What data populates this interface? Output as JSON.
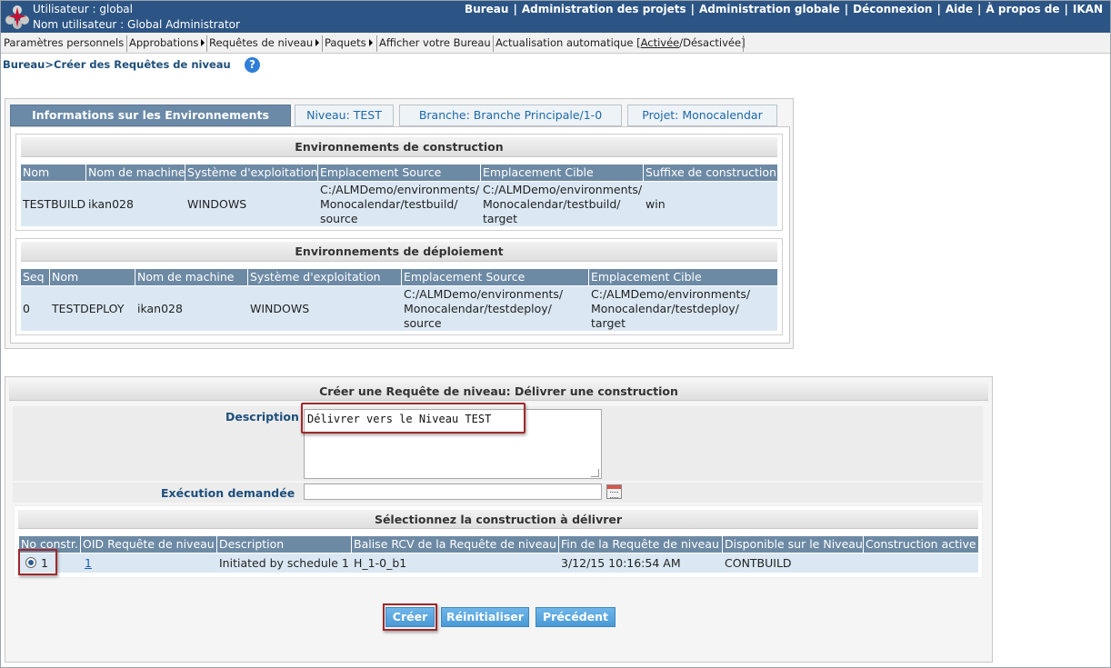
{
  "header": {
    "user_line": "Utilisateur : global",
    "name_line": "Nom utilisateur : Global Administrator",
    "nav": [
      "Bureau",
      "Administration des projets",
      "Administration globale",
      "Déconnexion",
      "Aide",
      "À propos de",
      "IKAN"
    ]
  },
  "menu": {
    "items": [
      "Paramètres personnels",
      "Approbations",
      "Requêtes de niveau",
      "Paquets",
      "Afficher votre Bureau",
      "Actualisation automatique ["
    ],
    "auto_active": "Activée",
    "auto_sep": "/",
    "auto_inactive": "Désactivée]"
  },
  "breadcrumb": "Bureau>Créer des Requêtes de niveau",
  "help_glyph": "?",
  "tabs": {
    "env": "Informations sur les Environnements",
    "niveau": "Niveau: TEST",
    "branche": "Branche: Branche Principale/1-0",
    "projet": "Projet: Monocalendar"
  },
  "build_env": {
    "title": "Environnements de construction",
    "headers": [
      "Nom",
      "Nom de machine",
      "Système d'exploitation",
      "Emplacement Source",
      "Emplacement Cible",
      "Suffixe de construction"
    ],
    "row": {
      "nom": "TESTBUILD",
      "machine": "ikan028",
      "os": "WINDOWS",
      "source": [
        "C:/ALMDemo/environments/",
        "Monocalendar/testbuild/",
        "source"
      ],
      "cible": [
        "C:/ALMDemo/environments/",
        "Monocalendar/testbuild/",
        "target"
      ],
      "suffixe": "win"
    }
  },
  "deploy_env": {
    "title": "Environnements de déploiement",
    "headers": [
      "Seq",
      "Nom",
      "Nom de machine",
      "Système d'exploitation",
      "Emplacement Source",
      "Emplacement Cible"
    ],
    "row": {
      "seq": "0",
      "nom": "TESTDEPLOY",
      "machine": "ikan028",
      "os": "WINDOWS",
      "source": [
        "C:/ALMDemo/environments/",
        "Monocalendar/testdeploy/",
        "source"
      ],
      "cible": [
        "C:/ALMDemo/environments/",
        "Monocalendar/testdeploy/",
        "target"
      ]
    }
  },
  "request": {
    "title": "Créer une Requête de niveau: Délivrer une construction",
    "description_label": "Description",
    "description_value": "Délivrer vers le Niveau TEST",
    "execution_label": "Exécution demandée",
    "execution_value": ""
  },
  "builds": {
    "title": "Sélectionnez la construction à délivrer",
    "headers": [
      "No constr.",
      "OID Requête de niveau",
      "Description",
      "Balise RCV de la Requête de niveau",
      "Fin de la Requête de niveau",
      "Disponible sur le Niveau",
      "Construction active"
    ],
    "row": {
      "no": "1",
      "oid": "1",
      "description": "Initiated by schedule 1",
      "balise": "H_1-0_b1",
      "fin": "3/12/15 10:16:54 AM",
      "disponible": "CONTBUILD",
      "active": ""
    }
  },
  "buttons": {
    "creer": "Créer",
    "reinitialiser": "Réinitialiser",
    "precedent": "Précédent"
  }
}
